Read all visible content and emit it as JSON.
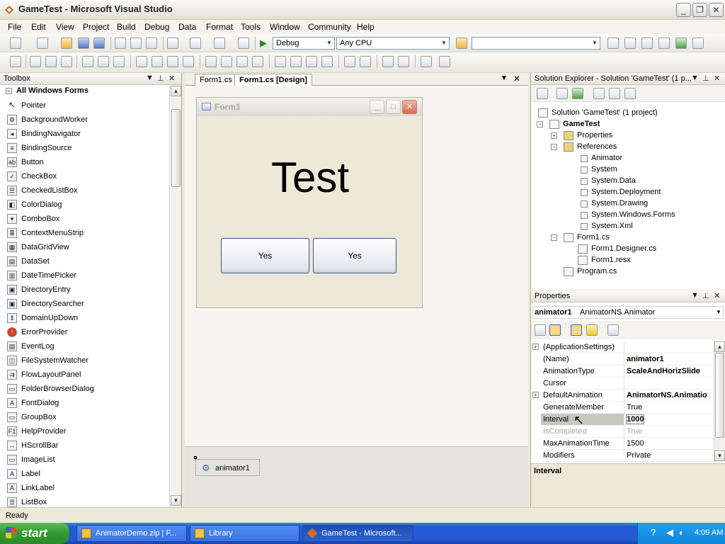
{
  "window": {
    "title": "GameTest - Microsoft Visual Studio"
  },
  "menu": [
    "File",
    "Edit",
    "View",
    "Project",
    "Build",
    "Debug",
    "Data",
    "Format",
    "Tools",
    "Window",
    "Community",
    "Help"
  ],
  "toolbar": {
    "config": "Debug",
    "platform": "Any CPU",
    "find": ""
  },
  "toolbox": {
    "title": "Toolbox",
    "group": "All Windows Forms",
    "items": [
      {
        "label": "Pointer",
        "icon": "pointer-icon",
        "glyph": "↖"
      },
      {
        "label": "BackgroundWorker",
        "icon": "background-worker-icon",
        "glyph": "⚙"
      },
      {
        "label": "BindingNavigator",
        "icon": "binding-navigator-icon",
        "glyph": "◂"
      },
      {
        "label": "BindingSource",
        "icon": "binding-source-icon",
        "glyph": "≡"
      },
      {
        "label": "Button",
        "icon": "button-icon",
        "glyph": "ab"
      },
      {
        "label": "CheckBox",
        "icon": "checkbox-icon",
        "glyph": "✓"
      },
      {
        "label": "CheckedListBox",
        "icon": "checked-listbox-icon",
        "glyph": "☰"
      },
      {
        "label": "ColorDialog",
        "icon": "color-dialog-icon",
        "glyph": "◧"
      },
      {
        "label": "ComboBox",
        "icon": "combobox-icon",
        "glyph": "▾"
      },
      {
        "label": "ContextMenuStrip",
        "icon": "context-menu-icon",
        "glyph": "≣"
      },
      {
        "label": "DataGridView",
        "icon": "data-grid-icon",
        "glyph": "▦"
      },
      {
        "label": "DataSet",
        "icon": "dataset-icon",
        "glyph": "▤"
      },
      {
        "label": "DateTimePicker",
        "icon": "date-picker-icon",
        "glyph": "▥"
      },
      {
        "label": "DirectoryEntry",
        "icon": "directory-entry-icon",
        "glyph": "▣"
      },
      {
        "label": "DirectorySearcher",
        "icon": "directory-searcher-icon",
        "glyph": "▣"
      },
      {
        "label": "DomainUpDown",
        "icon": "domain-updown-icon",
        "glyph": "⇕"
      },
      {
        "label": "ErrorProvider",
        "icon": "error-provider-icon",
        "glyph": "!"
      },
      {
        "label": "EventLog",
        "icon": "event-log-icon",
        "glyph": "▤"
      },
      {
        "label": "FileSystemWatcher",
        "icon": "file-watcher-icon",
        "glyph": "◫"
      },
      {
        "label": "FlowLayoutPanel",
        "icon": "flow-layout-icon",
        "glyph": "⇉"
      },
      {
        "label": "FolderBrowserDialog",
        "icon": "folder-browser-icon",
        "glyph": "▭"
      },
      {
        "label": "FontDialog",
        "icon": "font-dialog-icon",
        "glyph": "A"
      },
      {
        "label": "GroupBox",
        "icon": "groupbox-icon",
        "glyph": "▭"
      },
      {
        "label": "HelpProvider",
        "icon": "help-provider-icon",
        "glyph": "F1"
      },
      {
        "label": "HScrollBar",
        "icon": "hscrollbar-icon",
        "glyph": "↔"
      },
      {
        "label": "ImageList",
        "icon": "imagelist-icon",
        "glyph": "▭"
      },
      {
        "label": "Label",
        "icon": "label-icon",
        "glyph": "A"
      },
      {
        "label": "LinkLabel",
        "icon": "linklabel-icon",
        "glyph": "A"
      },
      {
        "label": "ListBox",
        "icon": "listbox-icon",
        "glyph": "☰"
      }
    ]
  },
  "editor": {
    "tabs": [
      "Form1.cs",
      "Form1.cs [Design]"
    ],
    "form_title": "Form1",
    "form_label": "Test",
    "buttons": [
      "Yes",
      "Yes"
    ],
    "component": "animator1"
  },
  "solution": {
    "title": "Solution Explorer - Solution 'GameTest' (1 p...",
    "nodes": [
      {
        "label": "Solution 'GameTest' (1 project)",
        "icon": "solution-icon",
        "bold": false
      },
      {
        "label": "GameTest",
        "icon": "project-icon",
        "bold": true
      },
      {
        "label": "Properties",
        "icon": "properties-folder-icon",
        "bold": false
      },
      {
        "label": "References",
        "icon": "folder-icon",
        "bold": false
      },
      {
        "label": "Animator",
        "icon": "reference-icon",
        "bold": false
      },
      {
        "label": "System",
        "icon": "reference-icon",
        "bold": false
      },
      {
        "label": "System.Data",
        "icon": "reference-icon",
        "bold": false
      },
      {
        "label": "System.Deployment",
        "icon": "reference-icon",
        "bold": false
      },
      {
        "label": "System.Drawing",
        "icon": "reference-icon",
        "bold": false
      },
      {
        "label": "System.Windows.Forms",
        "icon": "reference-icon",
        "bold": false
      },
      {
        "label": "System.Xml",
        "icon": "reference-icon",
        "bold": false
      },
      {
        "label": "Form1.cs",
        "icon": "form-icon",
        "bold": false
      },
      {
        "label": "Form1.Designer.cs",
        "icon": "cs-file-icon",
        "bold": false
      },
      {
        "label": "Form1.resx",
        "icon": "resx-file-icon",
        "bold": false
      },
      {
        "label": "Program.cs",
        "icon": "cs-file-icon",
        "bold": false
      }
    ]
  },
  "properties": {
    "title": "Properties",
    "object": "animator1",
    "object_type": "AnimatorNS.Animator",
    "rows": [
      {
        "name": "(ApplicationSettings)",
        "value": "",
        "bold": false,
        "expand": true
      },
      {
        "name": "(Name)",
        "value": "animator1",
        "bold": true,
        "expand": false
      },
      {
        "name": "AnimationType",
        "value": "ScaleAndHorizSlide",
        "bold": true,
        "expand": false
      },
      {
        "name": "Cursor",
        "value": "",
        "bold": false,
        "expand": false
      },
      {
        "name": "DefaultAnimation",
        "value": "AnimatorNS.Animatio",
        "bold": true,
        "expand": true
      },
      {
        "name": "GenerateMember",
        "value": "True",
        "bold": false,
        "expand": false
      },
      {
        "name": "Interval",
        "value": "1000",
        "bold": true,
        "expand": false,
        "selected": true
      },
      {
        "name": "IsCompleted",
        "value": "True",
        "bold": false,
        "expand": false,
        "disabled": true
      },
      {
        "name": "MaxAnimationTime",
        "value": "1500",
        "bold": false,
        "expand": false
      },
      {
        "name": "Modifiers",
        "value": "Private",
        "bold": false,
        "expand": false
      }
    ],
    "description": "Interval"
  },
  "status": "Ready",
  "taskbar": {
    "start": "start",
    "tasks": [
      "AnimatorDemo.zip | F...",
      "Library",
      "GameTest - Microsoft..."
    ],
    "clock": "4:09 AM"
  }
}
